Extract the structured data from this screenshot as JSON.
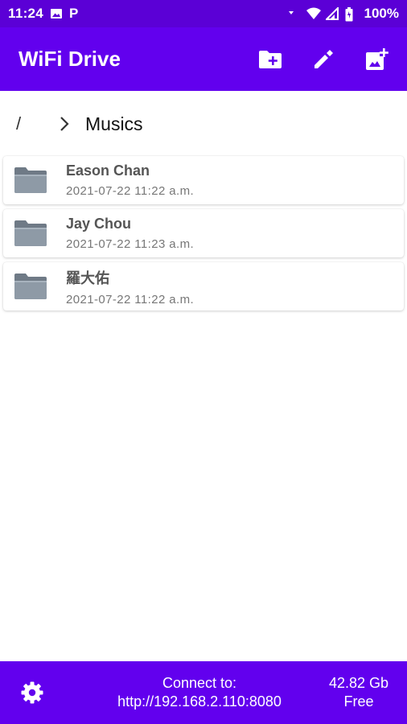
{
  "status_bar": {
    "time": "11:24",
    "p_badge": "P",
    "battery": "100%"
  },
  "app_bar": {
    "title": "WiFi Drive",
    "actions": [
      {
        "icon": "create-folder-icon"
      },
      {
        "icon": "edit-icon"
      },
      {
        "icon": "add-photo-icon"
      }
    ]
  },
  "breadcrumb": {
    "root": "/",
    "separator_icon": "chevron-right-icon",
    "current": "Musics"
  },
  "files": [
    {
      "name": "Eason Chan",
      "date": "2021-07-22  11:22  a.m.",
      "icon": "folder-icon"
    },
    {
      "name": "Jay Chou",
      "date": "2021-07-22  11:23  a.m.",
      "icon": "folder-icon"
    },
    {
      "name": "羅大佑",
      "date": "2021-07-22  11:22  a.m.",
      "icon": "folder-icon"
    }
  ],
  "bottom_bar": {
    "connect_label": "Connect to:",
    "connect_url": "http://192.168.2.110:8080",
    "storage_value": "42.82 Gb",
    "storage_label": "Free",
    "settings_icon": "gear-icon"
  },
  "colors": {
    "primary": "#6200ee",
    "status_bar": "#5b00d6",
    "background": "#ffffff"
  }
}
